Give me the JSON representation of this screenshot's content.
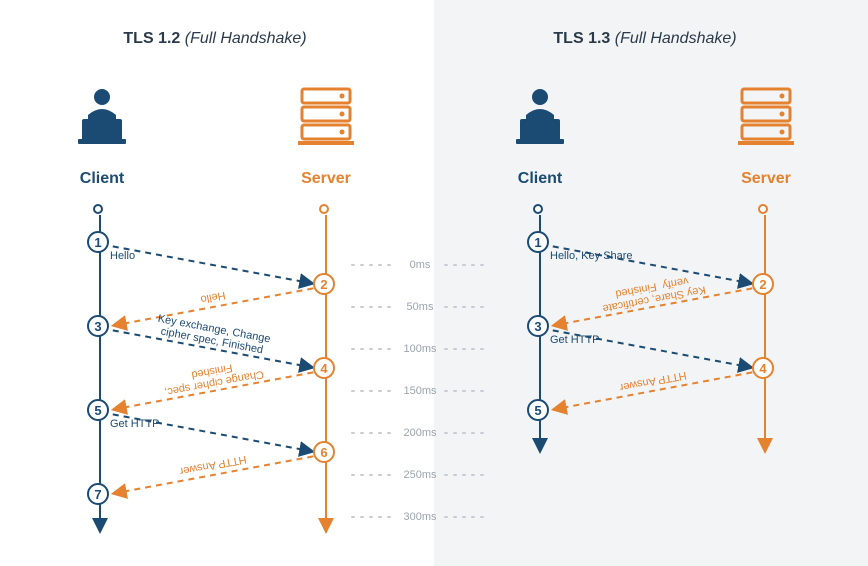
{
  "left": {
    "title_bold": "TLS 1.2",
    "title_ital": "(Full Handshake)",
    "client_label": "Client",
    "server_label": "Server",
    "messages": [
      {
        "step_from": 1,
        "step_to": 2,
        "label": "Hello",
        "color": "client"
      },
      {
        "step_from": 2,
        "step_to": 3,
        "label": "Hello",
        "color": "server"
      },
      {
        "step_from": 3,
        "step_to": 4,
        "label": "Key exchange, Change\ncipher spec, Finished",
        "color": "client"
      },
      {
        "step_from": 4,
        "step_to": 5,
        "label": "Change cipher spec,\nFinished",
        "color": "server"
      },
      {
        "step_from": 5,
        "step_to": 6,
        "label": "Get HTTP",
        "color": "client"
      },
      {
        "step_from": 6,
        "step_to": 7,
        "label": "HTTP Answer",
        "color": "server"
      }
    ],
    "client_steps": [
      1,
      3,
      5,
      7
    ],
    "server_steps": [
      2,
      4,
      6
    ]
  },
  "right": {
    "title_bold": "TLS 1.3",
    "title_ital": "(Full Handshake)",
    "client_label": "Client",
    "server_label": "Server",
    "messages": [
      {
        "step_from": 1,
        "step_to": 2,
        "label": "Hello, Key Share",
        "color": "client"
      },
      {
        "step_from": 2,
        "step_to": 3,
        "label": "Key Share, certificate\nverify  Finished",
        "color": "server"
      },
      {
        "step_from": 3,
        "step_to": 4,
        "label": "Get HTTP",
        "color": "client"
      },
      {
        "step_from": 4,
        "step_to": 5,
        "label": "HTTP Answer",
        "color": "server"
      }
    ],
    "client_steps": [
      1,
      3,
      5
    ],
    "server_steps": [
      2,
      4
    ]
  },
  "timeline": [
    "0ms",
    "50ms",
    "100ms",
    "150ms",
    "200ms",
    "250ms",
    "300ms"
  ],
  "colors": {
    "client": "#1b4b72",
    "server": "#e4822f",
    "dot": "#c7cdd3"
  }
}
